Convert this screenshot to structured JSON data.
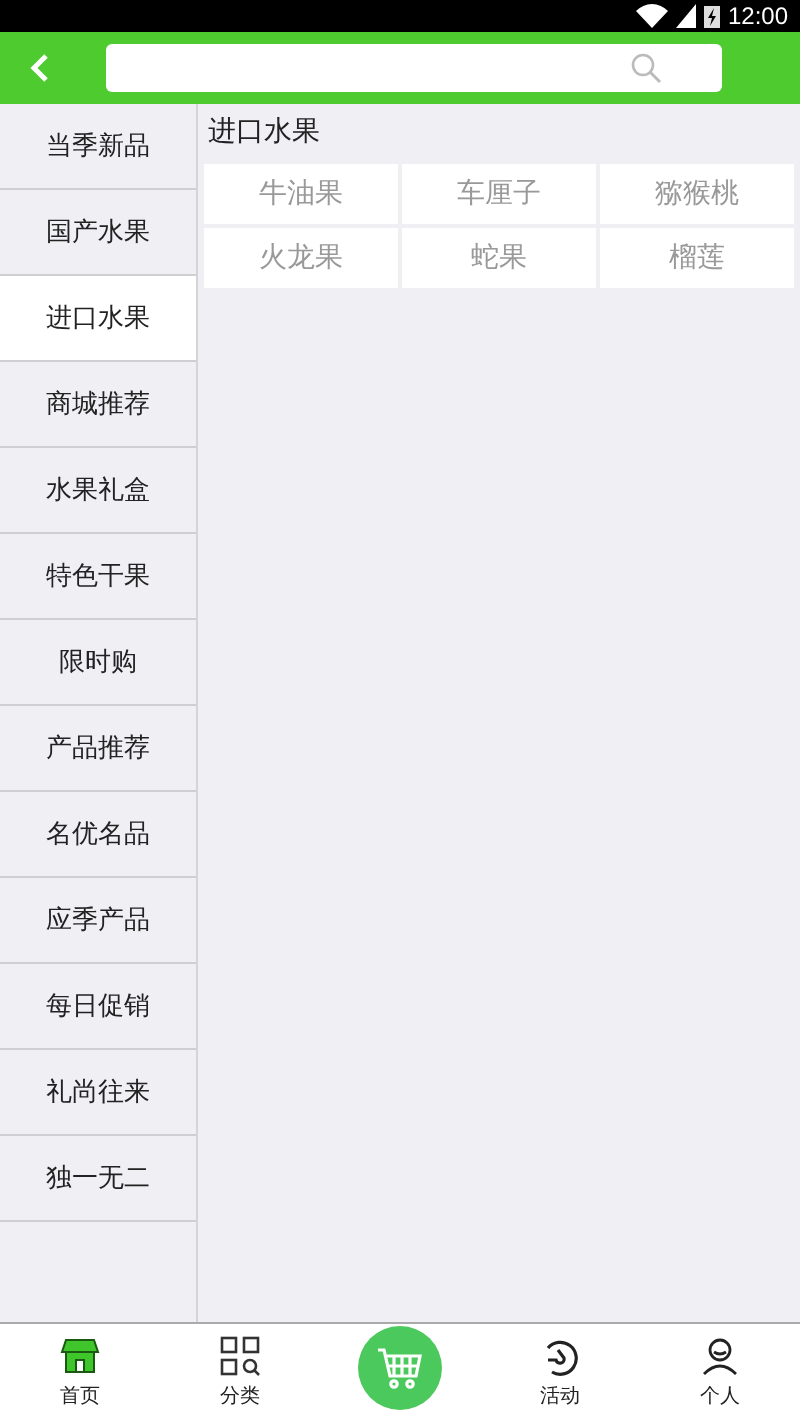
{
  "status_bar": {
    "time": "12:00"
  },
  "sidebar": {
    "items": [
      {
        "label": "当季新品",
        "selected": false
      },
      {
        "label": "国产水果",
        "selected": false
      },
      {
        "label": "进口水果",
        "selected": true
      },
      {
        "label": "商城推荐",
        "selected": false
      },
      {
        "label": "水果礼盒",
        "selected": false
      },
      {
        "label": "特色干果",
        "selected": false
      },
      {
        "label": "限时购",
        "selected": false
      },
      {
        "label": "产品推荐",
        "selected": false
      },
      {
        "label": "名优名品",
        "selected": false
      },
      {
        "label": "应季产品",
        "selected": false
      },
      {
        "label": "每日促销",
        "selected": false
      },
      {
        "label": "礼尚往来",
        "selected": false
      },
      {
        "label": "独一无二",
        "selected": false
      }
    ]
  },
  "content": {
    "title": "进口水果",
    "items": [
      "牛油果",
      "车厘子",
      "猕猴桃",
      "火龙果",
      "蛇果",
      "榴莲"
    ]
  },
  "tab_bar": {
    "items": [
      {
        "kind": "home",
        "label": "首页",
        "selected": true
      },
      {
        "kind": "category",
        "label": "分类",
        "selected": false
      },
      {
        "kind": "cart"
      },
      {
        "kind": "activity",
        "label": "活动",
        "selected": false
      },
      {
        "kind": "profile",
        "label": "个人",
        "selected": false
      }
    ]
  }
}
